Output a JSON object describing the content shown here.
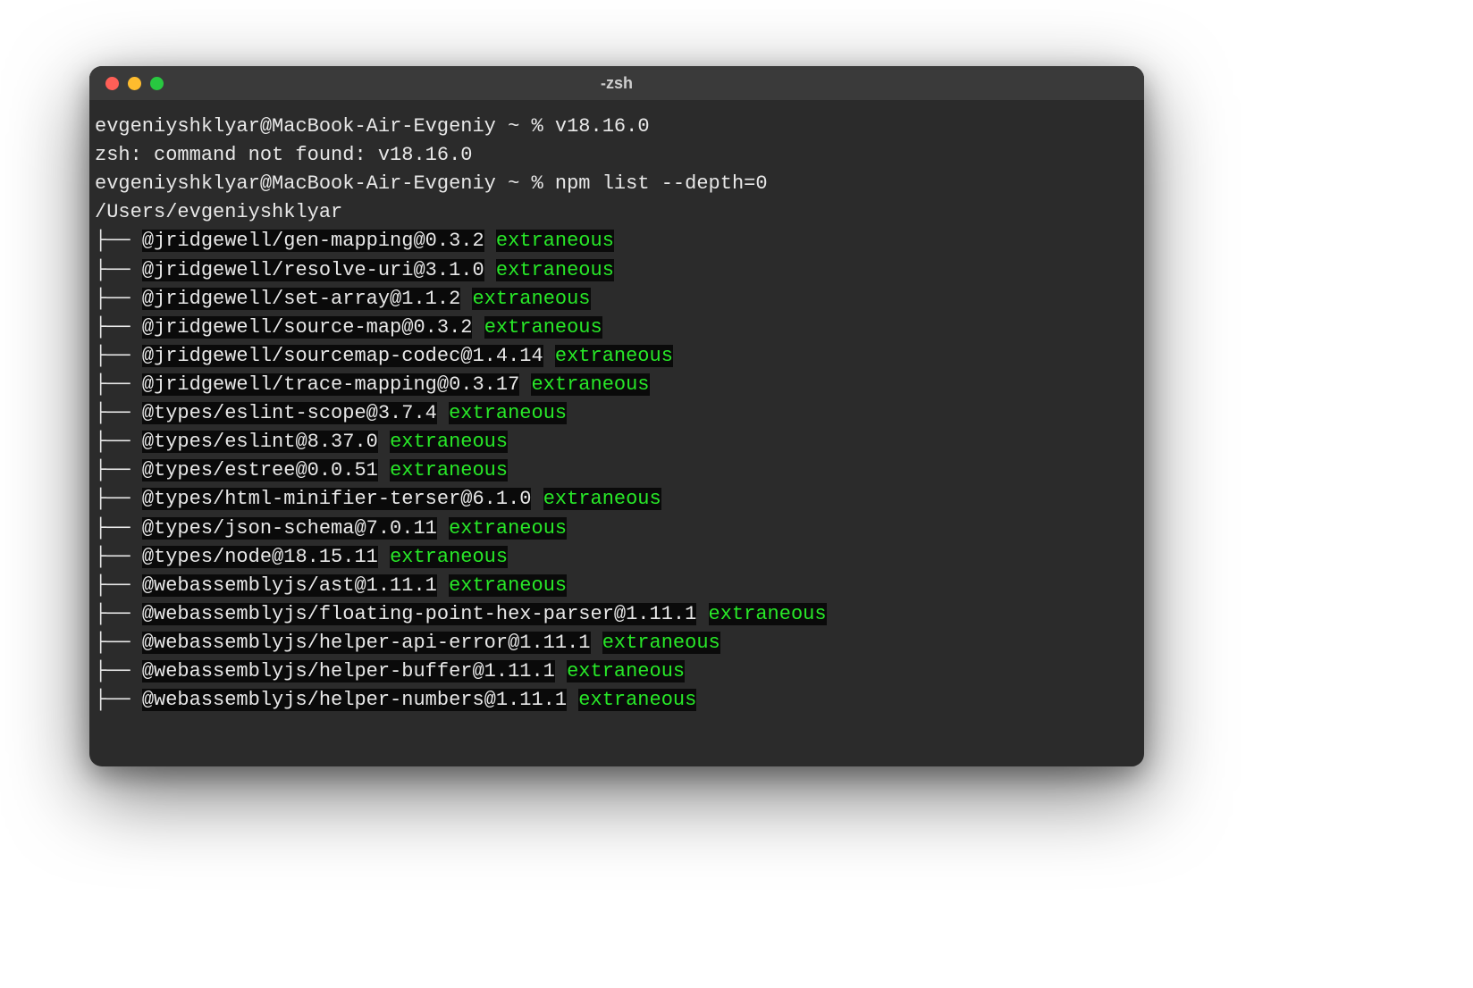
{
  "window": {
    "title": "-zsh"
  },
  "prompt": {
    "user": "evgeniyshklyar",
    "host": "MacBook-Air-Evgeniy",
    "dir": "~",
    "symbol": "%"
  },
  "lines": {
    "cmd1": "v18.16.0",
    "err1": "zsh: command not found: v18.16.0",
    "cmd2": "npm list --depth=0",
    "path": "/Users/evgeniyshklyar"
  },
  "tree_branch": "├── ",
  "extraneous_label": "extraneous",
  "packages": [
    "@jridgewell/gen-mapping@0.3.2",
    "@jridgewell/resolve-uri@3.1.0",
    "@jridgewell/set-array@1.1.2",
    "@jridgewell/source-map@0.3.2",
    "@jridgewell/sourcemap-codec@1.4.14",
    "@jridgewell/trace-mapping@0.3.17",
    "@types/eslint-scope@3.7.4",
    "@types/eslint@8.37.0",
    "@types/estree@0.0.51",
    "@types/html-minifier-terser@6.1.0",
    "@types/json-schema@7.0.11",
    "@types/node@18.15.11",
    "@webassemblyjs/ast@1.11.1",
    "@webassemblyjs/floating-point-hex-parser@1.11.1",
    "@webassemblyjs/helper-api-error@1.11.1",
    "@webassemblyjs/helper-buffer@1.11.1",
    "@webassemblyjs/helper-numbers@1.11.1"
  ]
}
